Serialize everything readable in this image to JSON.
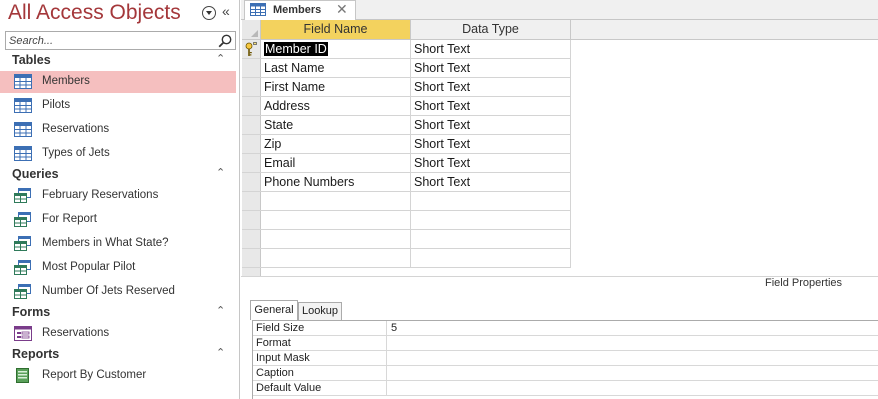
{
  "nav": {
    "title": "All Access Objects",
    "search_placeholder": "Search...",
    "groups": [
      {
        "label": "Tables",
        "items": [
          {
            "label": "Members",
            "icon": "table-icon",
            "selected": true
          },
          {
            "label": "Pilots",
            "icon": "table-icon"
          },
          {
            "label": "Reservations",
            "icon": "table-icon"
          },
          {
            "label": "Types of Jets",
            "icon": "table-icon"
          }
        ]
      },
      {
        "label": "Queries",
        "items": [
          {
            "label": "February Reservations",
            "icon": "query-icon"
          },
          {
            "label": "For Report",
            "icon": "query-icon"
          },
          {
            "label": "Members in What State?",
            "icon": "query-icon"
          },
          {
            "label": "Most Popular Pilot",
            "icon": "query-icon"
          },
          {
            "label": "Number Of Jets Reserved",
            "icon": "query-icon"
          }
        ]
      },
      {
        "label": "Forms",
        "items": [
          {
            "label": "Reservations",
            "icon": "form-icon"
          }
        ]
      },
      {
        "label": "Reports",
        "items": [
          {
            "label": "Report By Customer",
            "icon": "report-icon"
          }
        ]
      }
    ]
  },
  "document": {
    "tab_label": "Members",
    "columns": {
      "field_name": "Field Name",
      "data_type": "Data Type"
    },
    "rows": [
      {
        "field_name": "Member ID",
        "data_type": "Short Text",
        "primary_key": true
      },
      {
        "field_name": "Last Name",
        "data_type": "Short Text"
      },
      {
        "field_name": "First Name",
        "data_type": "Short Text"
      },
      {
        "field_name": "Address",
        "data_type": "Short Text"
      },
      {
        "field_name": "State",
        "data_type": "Short Text"
      },
      {
        "field_name": "Zip",
        "data_type": "Short Text"
      },
      {
        "field_name": "Email",
        "data_type": "Short Text"
      },
      {
        "field_name": "Phone Numbers",
        "data_type": "Short Text"
      }
    ],
    "empty_rows": 4
  },
  "field_properties": {
    "title": "Field Properties",
    "tabs": [
      "General",
      "Lookup"
    ],
    "rows": [
      {
        "name": "Field Size",
        "value": "5"
      },
      {
        "name": "Format",
        "value": ""
      },
      {
        "name": "Input Mask",
        "value": ""
      },
      {
        "name": "Caption",
        "value": ""
      },
      {
        "name": "Default Value",
        "value": ""
      }
    ]
  },
  "colors": {
    "title": "#a4373a",
    "selected_item": "#f5bfbf",
    "active_column_header": "#f3d25e"
  }
}
